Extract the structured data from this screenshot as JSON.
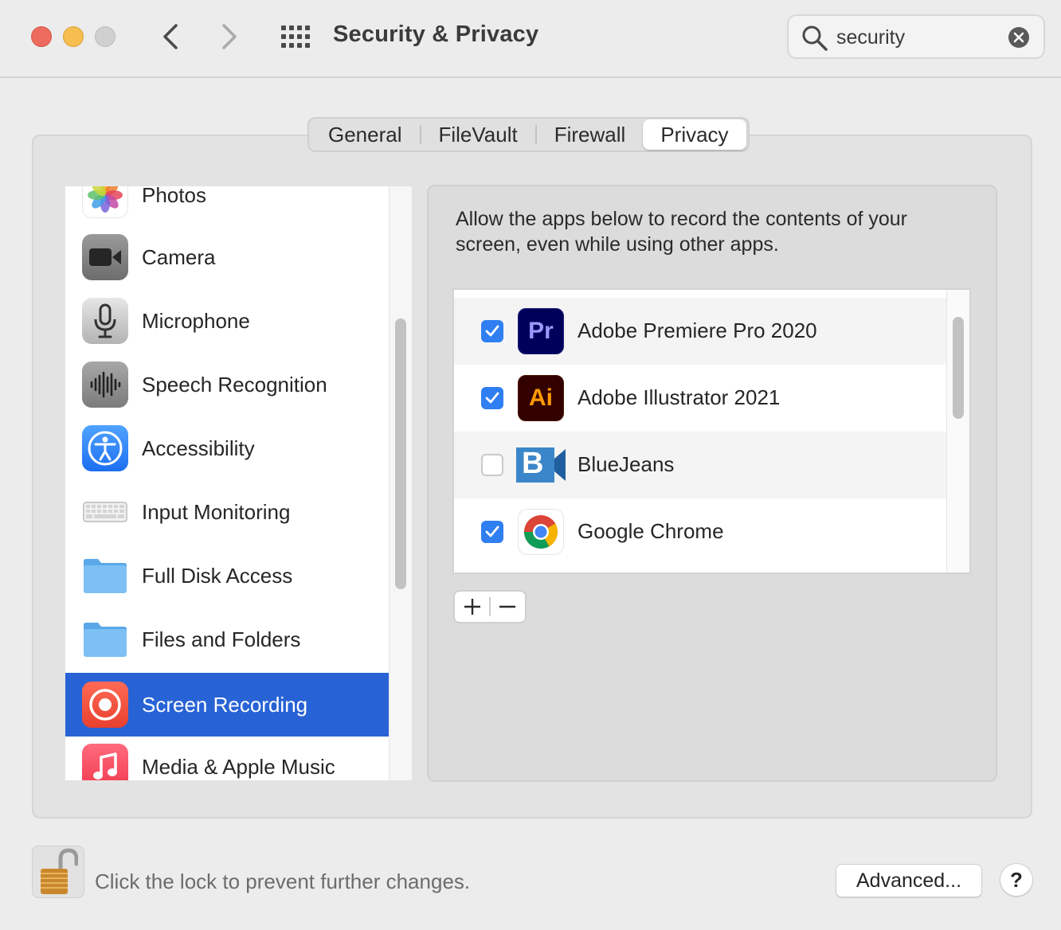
{
  "window": {
    "title": "Security & Privacy"
  },
  "search": {
    "value": "security",
    "icon": "search-icon",
    "clear_icon": "clear-icon"
  },
  "tabs": [
    {
      "label": "General",
      "active": false
    },
    {
      "label": "FileVault",
      "active": false
    },
    {
      "label": "Firewall",
      "active": false
    },
    {
      "label": "Privacy",
      "active": true
    }
  ],
  "sidebar": {
    "items": [
      {
        "label": "Photos",
        "icon": "photos-icon"
      },
      {
        "label": "Camera",
        "icon": "camera-icon"
      },
      {
        "label": "Microphone",
        "icon": "microphone-icon"
      },
      {
        "label": "Speech Recognition",
        "icon": "speech-recognition-icon"
      },
      {
        "label": "Accessibility",
        "icon": "accessibility-icon"
      },
      {
        "label": "Input Monitoring",
        "icon": "keyboard-icon"
      },
      {
        "label": "Full Disk Access",
        "icon": "folder-icon"
      },
      {
        "label": "Files and Folders",
        "icon": "folder-icon"
      },
      {
        "label": "Screen Recording",
        "icon": "screen-recording-icon",
        "selected": true
      },
      {
        "label": "Media & Apple Music",
        "icon": "music-icon"
      }
    ]
  },
  "main": {
    "description": "Allow the apps below to record the contents of your screen, even while using other apps.",
    "apps": [
      {
        "name": "Adobe Premiere Pro 2020",
        "checked": true,
        "icon": "premiere-pro-icon",
        "icon_text": "Pr"
      },
      {
        "name": "Adobe Illustrator 2021",
        "checked": true,
        "icon": "illustrator-icon",
        "icon_text": "Ai"
      },
      {
        "name": "BlueJeans",
        "checked": false,
        "icon": "bluejeans-icon",
        "icon_text": "B"
      },
      {
        "name": "Google Chrome",
        "checked": true,
        "icon": "chrome-icon"
      }
    ],
    "add_label": "+",
    "remove_label": "−"
  },
  "footer": {
    "lock_text": "Click the lock to prevent further changes.",
    "advanced_label": "Advanced...",
    "help_label": "?"
  },
  "colors": {
    "selection": "#2863d6",
    "checkbox": "#2f7ef2",
    "close": "#ed6a5e",
    "minimize": "#f5be4f"
  }
}
